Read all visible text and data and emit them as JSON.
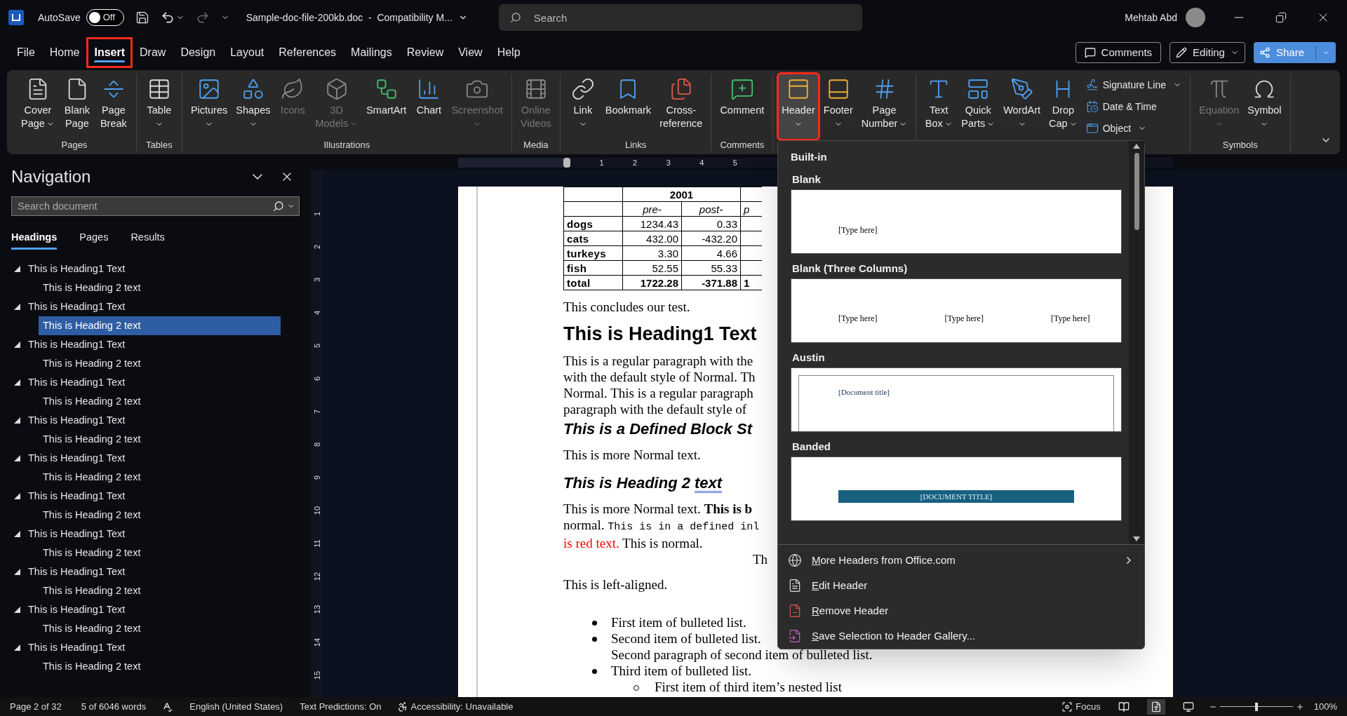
{
  "title_bar": {
    "autosave_label": "AutoSave",
    "autosave": {
      "on": false,
      "label": "Off"
    },
    "redo_disabled": true,
    "title": "Sample-doc-file-200kb.doc  -  Compatibility M...",
    "search": {
      "placeholder": "Search"
    },
    "user": "Mehtab Abd"
  },
  "tabs": [
    {
      "label": "File",
      "selected": false,
      "annotated": false
    },
    {
      "label": "Home",
      "selected": false,
      "annotated": false
    },
    {
      "label": "Insert",
      "selected": true,
      "annotated": true
    },
    {
      "label": "Draw",
      "selected": false,
      "annotated": false
    },
    {
      "label": "Design",
      "selected": false,
      "annotated": false
    },
    {
      "label": "Layout",
      "selected": false,
      "annotated": false
    },
    {
      "label": "References",
      "selected": false,
      "annotated": false
    },
    {
      "label": "Mailings",
      "selected": false,
      "annotated": false
    },
    {
      "label": "Review",
      "selected": false,
      "annotated": false
    },
    {
      "label": "View",
      "selected": false,
      "annotated": false
    },
    {
      "label": "Help",
      "selected": false,
      "annotated": false
    }
  ],
  "top_right": {
    "comments": "Comments",
    "editing": "Editing",
    "share": "Share"
  },
  "ribbon": {
    "groups": [
      {
        "label": "Pages",
        "buttons": [
          {
            "kind": "large",
            "lines": [
              "Cover",
              "Page"
            ],
            "dropdown": true,
            "disabled": false,
            "selected": false,
            "annotated": false
          },
          {
            "kind": "large",
            "lines": [
              "Blank",
              "Page"
            ],
            "dropdown": false,
            "disabled": false,
            "selected": false,
            "annotated": false
          },
          {
            "kind": "large",
            "lines": [
              "Page",
              "Break"
            ],
            "dropdown": false,
            "disabled": false,
            "selected": false,
            "annotated": false
          }
        ]
      },
      {
        "label": "Tables",
        "buttons": [
          {
            "kind": "large",
            "lines": [
              "Table"
            ],
            "dropdown": true,
            "disabled": false,
            "selected": false,
            "annotated": false
          }
        ]
      },
      {
        "label": "Illustrations",
        "buttons": [
          {
            "kind": "large",
            "lines": [
              "Pictures"
            ],
            "dropdown": true,
            "disabled": false,
            "selected": false,
            "annotated": false
          },
          {
            "kind": "large",
            "lines": [
              "Shapes"
            ],
            "dropdown": true,
            "disabled": false,
            "selected": false,
            "annotated": false
          },
          {
            "kind": "large",
            "lines": [
              "Icons"
            ],
            "dropdown": false,
            "disabled": true,
            "selected": false,
            "annotated": false
          },
          {
            "kind": "large",
            "lines": [
              "3D",
              "Models"
            ],
            "dropdown": true,
            "disabled": true,
            "selected": false,
            "annotated": false
          },
          {
            "kind": "large",
            "lines": [
              "SmartArt"
            ],
            "dropdown": false,
            "disabled": false,
            "selected": false,
            "annotated": false
          },
          {
            "kind": "large",
            "lines": [
              "Chart"
            ],
            "dropdown": false,
            "disabled": false,
            "selected": false,
            "annotated": false
          },
          {
            "kind": "large",
            "lines": [
              "Screenshot"
            ],
            "dropdown": true,
            "disabled": true,
            "selected": false,
            "annotated": false
          }
        ]
      },
      {
        "label": "Media",
        "buttons": [
          {
            "kind": "large",
            "lines": [
              "Online",
              "Videos"
            ],
            "dropdown": false,
            "disabled": true,
            "selected": false,
            "annotated": false
          }
        ]
      },
      {
        "label": "Links",
        "buttons": [
          {
            "kind": "large",
            "lines": [
              "Link"
            ],
            "dropdown": true,
            "disabled": false,
            "selected": false,
            "annotated": false
          },
          {
            "kind": "large",
            "lines": [
              "Bookmark"
            ],
            "dropdown": false,
            "disabled": false,
            "selected": false,
            "annotated": false
          },
          {
            "kind": "large",
            "lines": [
              "Cross-",
              "reference"
            ],
            "dropdown": false,
            "disabled": false,
            "selected": false,
            "annotated": false
          }
        ]
      },
      {
        "label": "Comments",
        "buttons": [
          {
            "kind": "large",
            "lines": [
              "Comment"
            ],
            "dropdown": false,
            "disabled": false,
            "selected": false,
            "annotated": false
          }
        ]
      },
      {
        "buttons": [
          {
            "kind": "large",
            "lines": [
              "Header"
            ],
            "dropdown": true,
            "disabled": false,
            "selected": true,
            "annotated": true
          },
          {
            "kind": "large",
            "lines": [
              "Footer"
            ],
            "dropdown": true,
            "disabled": false,
            "selected": false,
            "annotated": false
          },
          {
            "kind": "large",
            "lines": [
              "Page",
              "Number"
            ],
            "dropdown": true,
            "disabled": false,
            "selected": false,
            "annotated": false
          }
        ]
      },
      {
        "buttons": [
          {
            "kind": "large",
            "lines": [
              "Text",
              "Box"
            ],
            "dropdown": true,
            "disabled": false,
            "selected": false,
            "annotated": false
          },
          {
            "kind": "large",
            "lines": [
              "Quick",
              "Parts"
            ],
            "dropdown": true,
            "disabled": false,
            "selected": false,
            "annotated": false
          },
          {
            "kind": "large",
            "lines": [
              "WordArt"
            ],
            "dropdown": true,
            "disabled": false,
            "selected": false,
            "annotated": false
          },
          {
            "kind": "large",
            "lines": [
              "Drop",
              "Cap"
            ],
            "dropdown": true,
            "disabled": false,
            "selected": false,
            "annotated": false
          },
          {
            "kind": "small",
            "lines": [
              "Signature Line"
            ],
            "dropdown": true,
            "disabled": false,
            "selected": false,
            "annotated": false
          },
          {
            "kind": "small",
            "lines": [
              "Date & Time"
            ],
            "dropdown": false,
            "disabled": false,
            "selected": false,
            "annotated": false
          },
          {
            "kind": "small",
            "lines": [
              "Object"
            ],
            "dropdown": true,
            "disabled": false,
            "selected": false,
            "annotated": false
          }
        ]
      },
      {
        "label": "Symbols",
        "buttons": [
          {
            "kind": "large",
            "lines": [
              "Equation"
            ],
            "dropdown": true,
            "disabled": true,
            "selected": false,
            "annotated": false
          },
          {
            "kind": "large",
            "lines": [
              "Symbol"
            ],
            "dropdown": true,
            "disabled": false,
            "selected": false,
            "annotated": false
          }
        ]
      }
    ]
  },
  "navigation": {
    "title": "Navigation",
    "search": {
      "placeholder": "Search document"
    },
    "tabs": [
      {
        "label": "Headings",
        "selected": true
      },
      {
        "label": "Pages",
        "selected": false
      },
      {
        "label": "Results",
        "selected": false
      }
    ],
    "headings": [
      {
        "label": "This is Heading1 Text",
        "expanded": true,
        "selected": false,
        "children": [
          {
            "label": "This is Heading 2 text",
            "selected": false
          }
        ]
      },
      {
        "label": "This is Heading1 Text",
        "expanded": true,
        "selected": false,
        "children": [
          {
            "label": "This is Heading 2 text",
            "selected": true
          }
        ]
      },
      {
        "label": "This is Heading1 Text",
        "expanded": true,
        "selected": false,
        "children": [
          {
            "label": "This is Heading 2 text",
            "selected": false
          }
        ]
      },
      {
        "label": "This is Heading1 Text",
        "expanded": true,
        "selected": false,
        "children": [
          {
            "label": "This is Heading 2 text",
            "selected": false
          }
        ]
      },
      {
        "label": "This is Heading1 Text",
        "expanded": true,
        "selected": false,
        "children": [
          {
            "label": "This is Heading 2 text",
            "selected": false
          }
        ]
      },
      {
        "label": "This is Heading1 Text",
        "expanded": true,
        "selected": false,
        "children": [
          {
            "label": "This is Heading 2 text",
            "selected": false
          }
        ]
      },
      {
        "label": "This is Heading1 Text",
        "expanded": true,
        "selected": false,
        "children": [
          {
            "label": "This is Heading 2 text",
            "selected": false
          }
        ]
      },
      {
        "label": "This is Heading1 Text",
        "expanded": true,
        "selected": false,
        "children": [
          {
            "label": "This is Heading 2 text",
            "selected": false
          }
        ]
      },
      {
        "label": "This is Heading1 Text",
        "expanded": true,
        "selected": false,
        "children": [
          {
            "label": "This is Heading 2 text",
            "selected": false
          }
        ]
      },
      {
        "label": "This is Heading1 Text",
        "expanded": true,
        "selected": false,
        "children": [
          {
            "label": "This is Heading 2 text",
            "selected": false
          }
        ]
      },
      {
        "label": "This is Heading1 Text",
        "expanded": true,
        "selected": false,
        "children": [
          {
            "label": "This is Heading 2 text",
            "selected": false
          }
        ]
      }
    ]
  },
  "rulers": {
    "horizontal": [
      "1",
      "2",
      "3",
      "4",
      "5"
    ],
    "vertical": [
      "1",
      "2",
      "3",
      "4",
      "5",
      "6",
      "7",
      "8",
      "9",
      "10",
      "11",
      "12",
      "13",
      "14",
      "15"
    ]
  },
  "document": {
    "table": {
      "year": "2001",
      "columns": [
        "pre-",
        "post-"
      ],
      "cut_header": "p",
      "rows": [
        {
          "label": "dogs",
          "values": [
            "1234.43",
            "0.33"
          ],
          "bold": false
        },
        {
          "label": "cats",
          "values": [
            "432.00",
            "-432.20"
          ],
          "bold": false
        },
        {
          "label": "turkeys",
          "values": [
            "3.30",
            "4.66"
          ],
          "bold": false
        },
        {
          "label": "fish",
          "values": [
            "52.55",
            "55.33"
          ],
          "bold": false
        },
        {
          "label": "total",
          "values": [
            "1722.28",
            "-371.88"
          ],
          "bold": true,
          "cut": "1"
        }
      ]
    },
    "blocks": [
      {
        "kind": "normal",
        "lines": [
          "This concludes our test."
        ]
      },
      {
        "kind": "heading1",
        "lines": [
          "This is Heading1 Text"
        ]
      },
      {
        "kind": "normal",
        "lines": [
          "This is a regular paragraph with the",
          "with the default style of Normal. Th",
          "Normal. This is a regular paragraph",
          "paragraph with the default style of"
        ]
      },
      {
        "kind": "block_style",
        "lines": [
          "This is a Defined Block St"
        ]
      },
      {
        "kind": "normal",
        "lines": [
          "This is more Normal text."
        ]
      },
      {
        "kind": "heading2",
        "lines": [
          [
            {
              "text": "This is Heading 2 ",
              "kind": "plain"
            },
            {
              "text": "text",
              "kind": "flagged"
            }
          ]
        ]
      },
      {
        "kind": "normal",
        "lines": [
          [
            {
              "text": "This is more Normal text. ",
              "kind": "plain"
            },
            {
              "text": "This is b",
              "kind": "bold"
            }
          ],
          [
            {
              "text": "normal. ",
              "kind": "plain"
            },
            {
              "text": "This is in a defined inl",
              "kind": "mono"
            }
          ],
          [
            {
              "text": "is red text.",
              "kind": "red"
            },
            {
              "text": " This is normal.",
              "kind": "plain"
            }
          ]
        ]
      },
      {
        "kind": "centered",
        "lines": [
          "Th"
        ]
      },
      {
        "kind": "normal",
        "lines": [
          "This is left-aligned."
        ]
      }
    ],
    "list": [
      {
        "lines": [
          "First item of bulleted list."
        ]
      },
      {
        "lines": [
          "Second item of bulleted list.",
          "Second paragraph of second item of bulleted list."
        ]
      },
      {
        "lines": [
          "Third item of bulleted list."
        ],
        "children": [
          {
            "lines": [
              "First item of third item’s nested list"
            ]
          }
        ]
      }
    ]
  },
  "header_menu": {
    "section": "Built-in",
    "gallery": [
      {
        "kind": "blank",
        "label": "Blank",
        "texts": [
          "[Type here]"
        ]
      },
      {
        "kind": "three_columns",
        "label": "Blank (Three Columns)",
        "texts": [
          "[Type here]",
          "[Type here]",
          "[Type here]"
        ]
      },
      {
        "kind": "austin",
        "label": "Austin",
        "texts": [
          "[Document title]"
        ]
      },
      {
        "kind": "banded",
        "label": "Banded",
        "texts": [
          "[DOCUMENT TITLE]"
        ]
      }
    ],
    "items": [
      {
        "label": "More Headers from Office.com",
        "submenu": true
      },
      {
        "label": "Edit Header",
        "submenu": false
      },
      {
        "label": "Remove Header",
        "submenu": false
      },
      {
        "label": "Save Selection to Header Gallery...",
        "submenu": false
      }
    ]
  },
  "status_bar": {
    "page": "Page 2 of 32",
    "words": "5 of 6046 words",
    "language": "English (United States)",
    "predictions": "Text Predictions: On",
    "accessibility": "Accessibility: Unavailable",
    "focus": "Focus",
    "views": [
      {
        "selected": false
      },
      {
        "selected": true
      },
      {
        "selected": false
      }
    ],
    "zoom": {
      "level": 0.5,
      "label": "100%"
    }
  }
}
